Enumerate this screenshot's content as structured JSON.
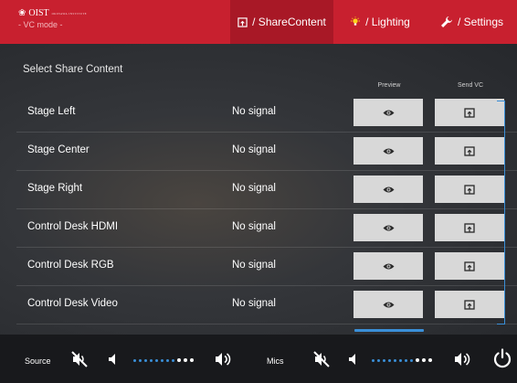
{
  "brand": {
    "logo_text": "OIST",
    "logo_sub": "OKINAWA INSTITUTE",
    "mode": "- VC mode -"
  },
  "tabs": [
    {
      "label": "/ ShareContent",
      "icon": "share-screen-icon",
      "active": true
    },
    {
      "label": "/ Lighting",
      "icon": "lightbulb-icon",
      "active": false
    },
    {
      "label": "/ Settings",
      "icon": "wrench-icon",
      "active": false
    }
  ],
  "content": {
    "title": "Select Share Content",
    "col_preview": "Preview",
    "col_send": "Send VC",
    "rows": [
      {
        "name": "Stage Left",
        "status": "No signal"
      },
      {
        "name": "Stage Center",
        "status": "No signal"
      },
      {
        "name": "Stage Right",
        "status": "No signal"
      },
      {
        "name": "Control Desk HDMI",
        "status": "No signal"
      },
      {
        "name": "Control Desk RGB",
        "status": "No signal"
      },
      {
        "name": "Control Desk Video",
        "status": "No signal"
      }
    ]
  },
  "footer": {
    "source_label": "Source",
    "mics_label": "Mics",
    "source_level_filled": 8,
    "source_level_total": 11,
    "mics_level_filled": 8,
    "mics_level_total": 11
  },
  "colors": {
    "header": "#c8202f",
    "accent": "#3a8fd8",
    "button": "#d8d8d8"
  }
}
